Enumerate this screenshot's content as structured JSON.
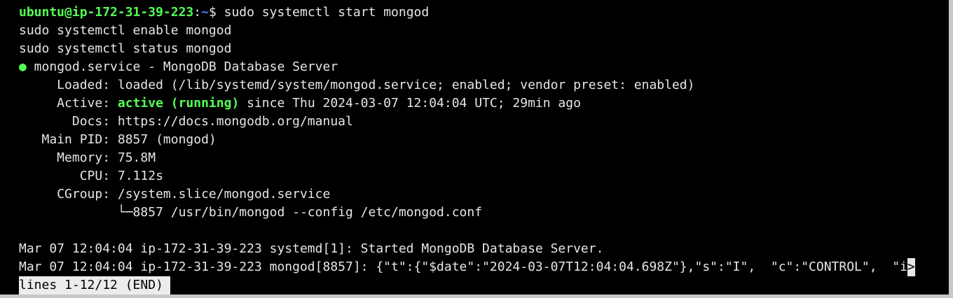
{
  "prompt": {
    "user_host": "ubuntu@ip-172-31-39-223",
    "sep": ":",
    "path": "~",
    "dollar": "$ ",
    "command": "sudo systemctl start mongod"
  },
  "echo_lines": [
    "sudo systemctl enable mongod",
    "sudo systemctl status mongod"
  ],
  "service": {
    "bullet": "●",
    "header": " mongod.service - MongoDB Database Server",
    "loaded": "     Loaded: loaded (/lib/systemd/system/mongod.service; enabled; vendor preset: enabled)",
    "active_label": "     Active: ",
    "active_state": "active (running)",
    "active_rest": " since Thu 2024-03-07 12:04:04 UTC; 29min ago",
    "docs": "       Docs: https://docs.mongodb.org/manual",
    "main_pid": "   Main PID: 8857 (mongod)",
    "memory": "     Memory: 75.8M",
    "cpu": "        CPU: 7.112s",
    "cgroup": "     CGroup: /system.slice/mongod.service",
    "cgroup_child": "             └─8857 /usr/bin/mongod --config /etc/mongod.conf"
  },
  "logs": [
    "Mar 07 12:04:04 ip-172-31-39-223 systemd[1]: Started MongoDB Database Server.",
    "Mar 07 12:04:04 ip-172-31-39-223 mongod[8857]: {\"t\":{\"$date\":\"2024-03-07T12:04:04.698Z\"},\"s\":\"I\",  \"c\":\"CONTROL\",  \"i"
  ],
  "truncation_marker": ">",
  "pager_status": "lines 1-12/12 (END)"
}
